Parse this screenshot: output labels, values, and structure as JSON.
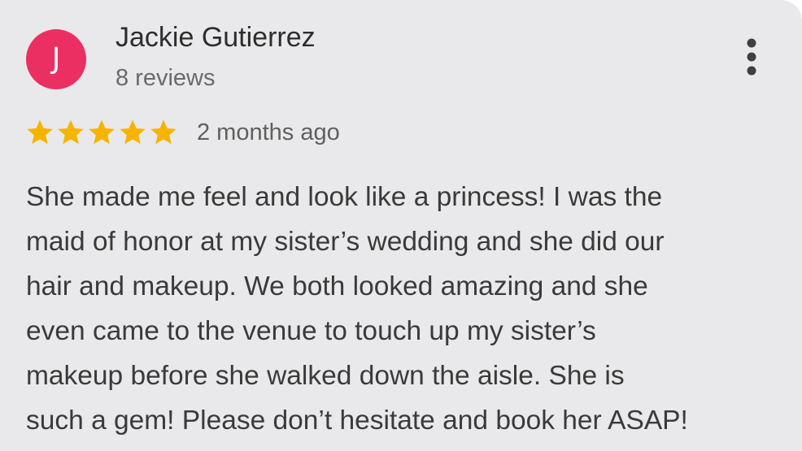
{
  "reviewer": {
    "avatar_initial": "J",
    "avatar_color": "#ec2f63",
    "name": "Jackie Gutierrez",
    "review_count": "8 reviews"
  },
  "menu": {
    "icon": "more-vert-icon"
  },
  "rating": {
    "stars": 5,
    "max_stars": 5,
    "star_color": "#f6b400",
    "time_ago": "2 months ago"
  },
  "review": {
    "lines": [
      "She made me feel and look like a princess! I was the",
      "maid of honor at my sister’s wedding and she did our",
      "hair and makeup. We both looked amazing and she",
      "even came to the venue to touch up my sister’s",
      "makeup before she walked down the aisle. She is",
      "such a gem! Please don’t hesitate and book her ASAP!"
    ]
  }
}
